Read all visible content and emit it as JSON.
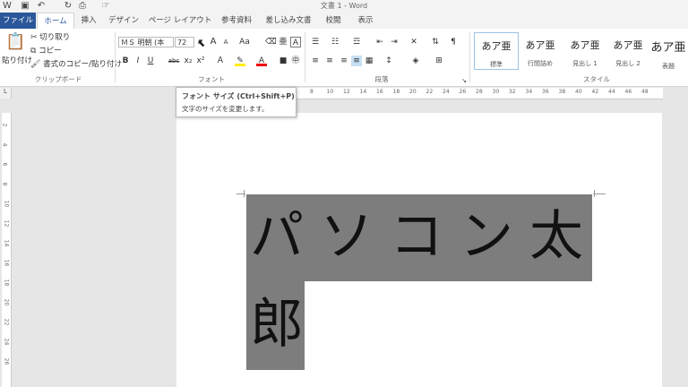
{
  "window": {
    "title": "文書 1 - Word"
  },
  "tabs": [
    "ファイル",
    "ホーム",
    "挿入",
    "デザイン",
    "ページ レイアウト",
    "参考資料",
    "差し込み文書",
    "校閲",
    "表示"
  ],
  "clipboard": {
    "paste": "貼り付け",
    "cut": "切り取り",
    "copy": "コピー",
    "format_painter": "書式のコピー/貼り付け",
    "label": "クリップボード"
  },
  "font": {
    "name": "ＭＳ 明朝 (本",
    "size": "72",
    "label": "フォント",
    "grow": "A",
    "shrink": "A",
    "case": "Aa",
    "bold": "B",
    "italic": "I",
    "underline": "U",
    "strike": "abc",
    "sub": "x₂",
    "sup": "x²"
  },
  "paragraph": {
    "label": "段落"
  },
  "styles": {
    "label": "スタイル",
    "items": [
      {
        "sample": "あア亜",
        "name": "標準"
      },
      {
        "sample": "あア亜",
        "name": "行間詰め"
      },
      {
        "sample": "あア亜",
        "name": "見出し 1"
      },
      {
        "sample": "あア亜",
        "name": "見出し 2"
      },
      {
        "sample": "あア亜",
        "name": "表題"
      }
    ]
  },
  "tooltip": {
    "title": "フォント サイズ (Ctrl+Shift+P)",
    "body": "文字のサイズを変更します。"
  },
  "ruler": {
    "h": [
      "8",
      "6",
      "4",
      "2",
      "",
      "2",
      "4",
      "6",
      "8",
      "10",
      "12",
      "14",
      "16",
      "18",
      "20",
      "22",
      "24",
      "26",
      "28",
      "30",
      "32",
      "34",
      "36",
      "38",
      "40",
      "42",
      "44",
      "46",
      "48"
    ],
    "v": [
      "2",
      "4",
      "6",
      "8",
      "10",
      "12",
      "14",
      "16",
      "18",
      "20",
      "22",
      "24",
      "26"
    ]
  },
  "document": {
    "line1": "パソコン太",
    "line2": "郎"
  }
}
